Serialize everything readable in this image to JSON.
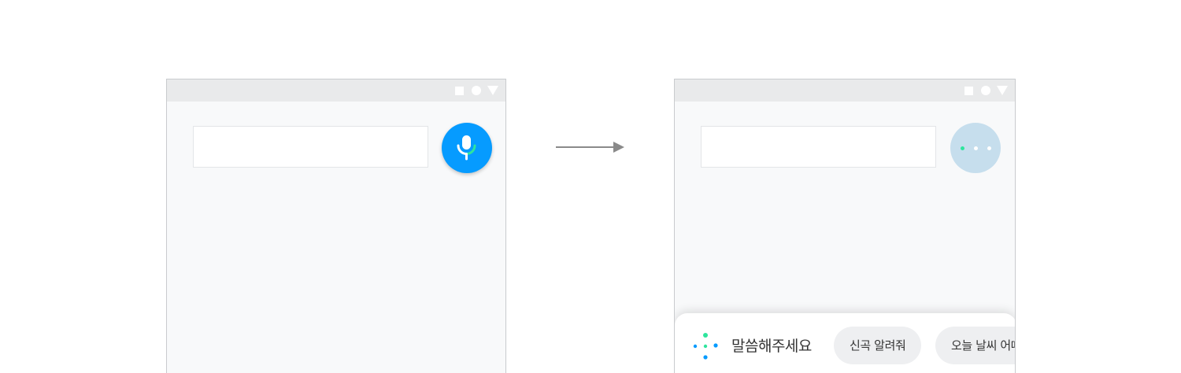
{
  "voice": {
    "prompt": "말씀해주세요",
    "suggestions": [
      "신곡 알려줘",
      "오늘 날씨 어때"
    ]
  },
  "colors": {
    "mic_button": "#069bff",
    "listening_button": "#c6deed",
    "accent_green": "#2ee59d",
    "status_bar": "#e9eaeb",
    "screen_background": "#f8f9fa"
  },
  "icons": {
    "mic": "mic-icon",
    "listening": "listening-dots-icon",
    "voice_animation": "voice-dots-icon",
    "arrow": "arrow-right-icon"
  }
}
